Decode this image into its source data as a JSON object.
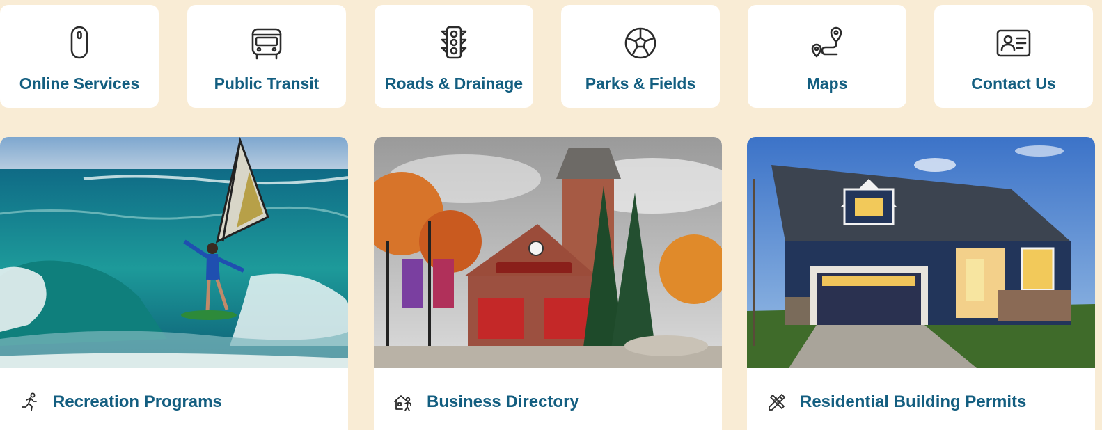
{
  "quick_links": [
    {
      "label": "Online Services",
      "icon": "mouse-icon"
    },
    {
      "label": "Public Transit",
      "icon": "bus-icon"
    },
    {
      "label": "Roads & Drainage",
      "icon": "traffic-light-icon"
    },
    {
      "label": "Parks & Fields",
      "icon": "soccer-ball-icon"
    },
    {
      "label": "Maps",
      "icon": "route-map-icon"
    },
    {
      "label": "Contact Us",
      "icon": "contact-card-icon"
    }
  ],
  "feature_cards": [
    {
      "label": "Recreation Programs",
      "icon": "running-person-icon",
      "image": "windsurfer-photo"
    },
    {
      "label": "Business Directory",
      "icon": "business-person-icon",
      "image": "village-fire-hall-photo"
    },
    {
      "label": "Residential Building Permits",
      "icon": "pencil-ruler-icon",
      "image": "house-photo"
    }
  ],
  "colors": {
    "background": "#f9ecd5",
    "card": "#ffffff",
    "accent_text": "#135e80",
    "icon": "#2b2b2b"
  }
}
